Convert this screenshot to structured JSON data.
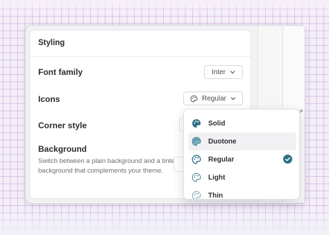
{
  "panel": {
    "title": "Styling",
    "font_family": {
      "label": "Font family",
      "value": "Inter"
    },
    "icons": {
      "label": "Icons",
      "value": "Regular"
    },
    "corner_style": {
      "label": "Corner style"
    },
    "background": {
      "label": "Background",
      "description": "Switch between a plain background and a tinted background that complements your theme."
    }
  },
  "icon_dropdown": {
    "options": [
      {
        "label": "Solid",
        "icon": "palette-solid-icon"
      },
      {
        "label": "Duotone",
        "icon": "palette-duotone-icon",
        "hovered": true
      },
      {
        "label": "Regular",
        "icon": "palette-regular-icon",
        "selected": true
      },
      {
        "label": "Light",
        "icon": "palette-light-icon"
      },
      {
        "label": "Thin",
        "icon": "palette-thin-icon"
      }
    ]
  },
  "colors": {
    "accent": "#2f7185",
    "icon_duotone": "#7db2c2"
  }
}
